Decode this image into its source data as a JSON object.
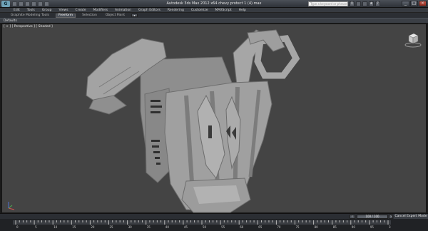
{
  "window": {
    "title": "Autodesk 3ds Max 2012 x64    chevy protect 1 (4).max",
    "app_logo": "G",
    "search_placeholder": "Type a keyword or phrase",
    "controls": {
      "minimize": "_",
      "maximize": "□",
      "close": "×"
    }
  },
  "menubar": {
    "items": [
      "Edit",
      "Tools",
      "Group",
      "Views",
      "Create",
      "Modifiers",
      "Animation",
      "Graph Editors",
      "Rendering",
      "Customize",
      "MAXScript",
      "Help"
    ]
  },
  "ribbon": {
    "tabs": [
      "Graphite Modeling Tools",
      "Freeform",
      "Selection",
      "Object Paint"
    ],
    "active_tab": "Freeform",
    "panel_label": "Defaults",
    "toggle_label": "▾"
  },
  "viewport": {
    "label": "[ + ] [ Perspective ] [ Shaded ]",
    "background": "#444444",
    "model_color": "#9a9a9a"
  },
  "timeline": {
    "frame_display": "100 / 100",
    "cancel_label": "Cancel Expert Mode"
  },
  "trackbar": {
    "ticks": [
      "0",
      "5",
      "10",
      "15",
      "20",
      "25",
      "30",
      "35",
      "40",
      "45",
      "50",
      "55",
      "60",
      "65",
      "70",
      "75",
      "80",
      "85",
      "90",
      "95",
      "100"
    ]
  },
  "icons": {
    "viewcube": "viewcube-icon",
    "axis": "axis-tripod-icon"
  }
}
